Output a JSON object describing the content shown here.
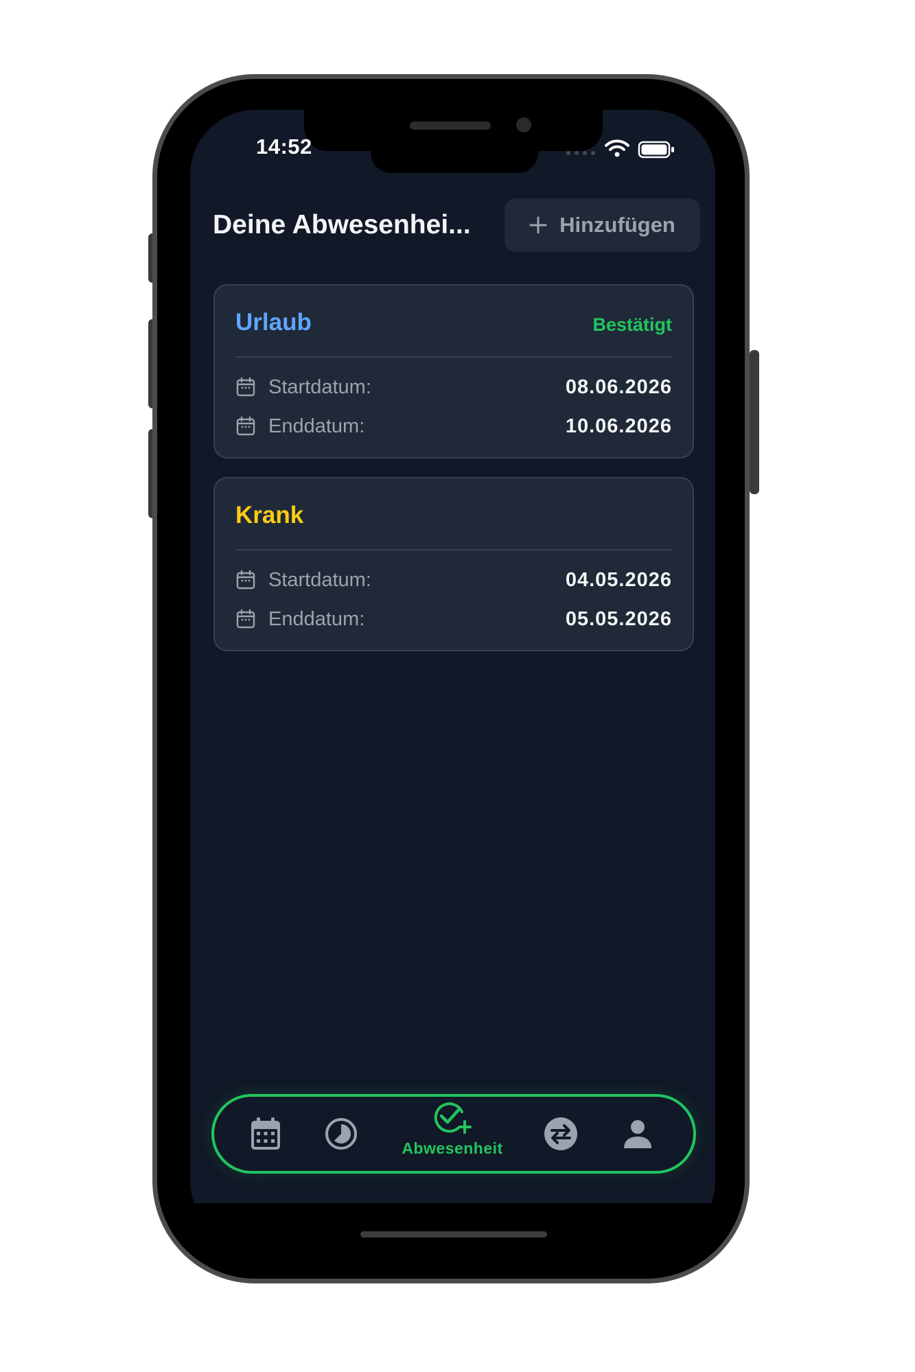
{
  "status_bar": {
    "time": "14:52"
  },
  "header": {
    "title": "Deine Abwesenhei...",
    "add_button_label": "Hinzufügen"
  },
  "absences": [
    {
      "type": "Urlaub",
      "type_color": "#60a5fa",
      "status": "Bestätigt",
      "start_label": "Startdatum:",
      "start_date": "08.06.2026",
      "end_label": "Enddatum:",
      "end_date": "10.06.2026"
    },
    {
      "type": "Krank",
      "type_color": "#facc15",
      "status": "",
      "start_label": "Startdatum:",
      "start_date": "04.05.2026",
      "end_label": "Enddatum:",
      "end_date": "05.05.2026"
    }
  ],
  "nav": {
    "items": [
      {
        "icon": "calendar-grid-icon",
        "label": ""
      },
      {
        "icon": "clock-pie-icon",
        "label": ""
      },
      {
        "icon": "check-plus-icon",
        "label": "Abwesenheit",
        "active": true
      },
      {
        "icon": "swap-arrows-icon",
        "label": ""
      },
      {
        "icon": "person-icon",
        "label": ""
      }
    ],
    "active_color": "#22c55e",
    "inactive_color": "#9ca3af"
  },
  "colors": {
    "background": "#111827",
    "card": "#1f2937",
    "accent": "#22c55e"
  }
}
